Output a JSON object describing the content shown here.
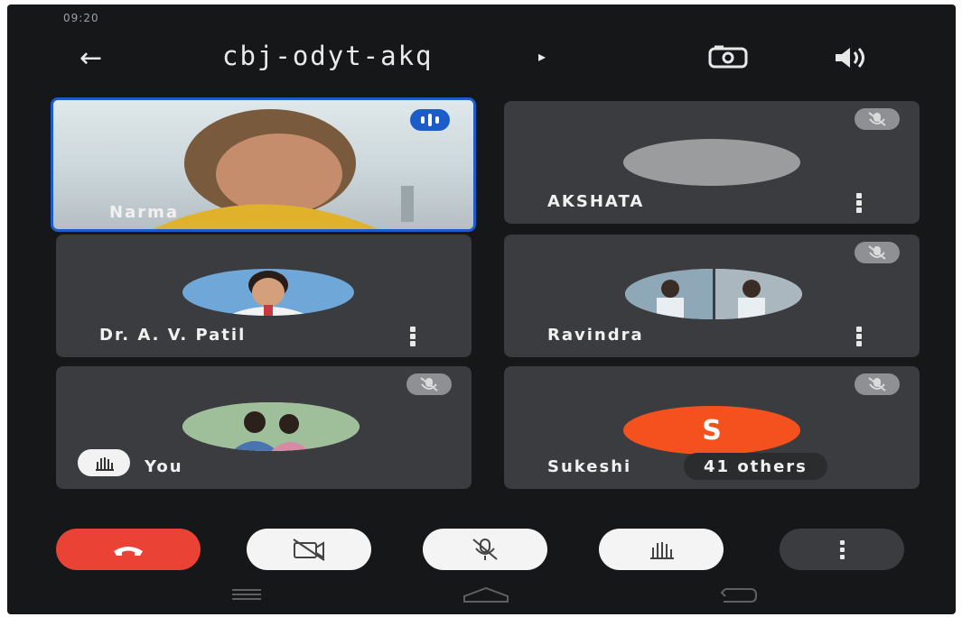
{
  "status_bar": {
    "time": "09:20",
    "network": "",
    "right_icons": ""
  },
  "meeting": {
    "code": "cbj-odyt-akq"
  },
  "participants": [
    {
      "name": "Narma",
      "speaking": true
    },
    {
      "name": "AKSHATA",
      "muted": true
    },
    {
      "name": "Dr. A. V. Patil"
    },
    {
      "name": "Ravindra",
      "muted": true
    },
    {
      "name": "You",
      "muted": true,
      "hand_raised": true
    },
    {
      "name": "Sukeshi",
      "muted": true,
      "avatar_letter": "S"
    }
  ],
  "others_pill": "41 others",
  "controls": [
    "end-call",
    "camera-off",
    "mic-off",
    "raise-hand",
    "more-options"
  ],
  "colors": {
    "end_call": "#ea4335",
    "active_speaker": "#1a5cc8",
    "sukeshi_avatar": "#f4511e"
  },
  "icons": [
    "back-arrow-icon",
    "switch-camera-icon",
    "speaker-icon",
    "mic-off-icon",
    "hand-icon",
    "nav-recents-icon",
    "nav-home-icon",
    "nav-back-icon"
  ]
}
